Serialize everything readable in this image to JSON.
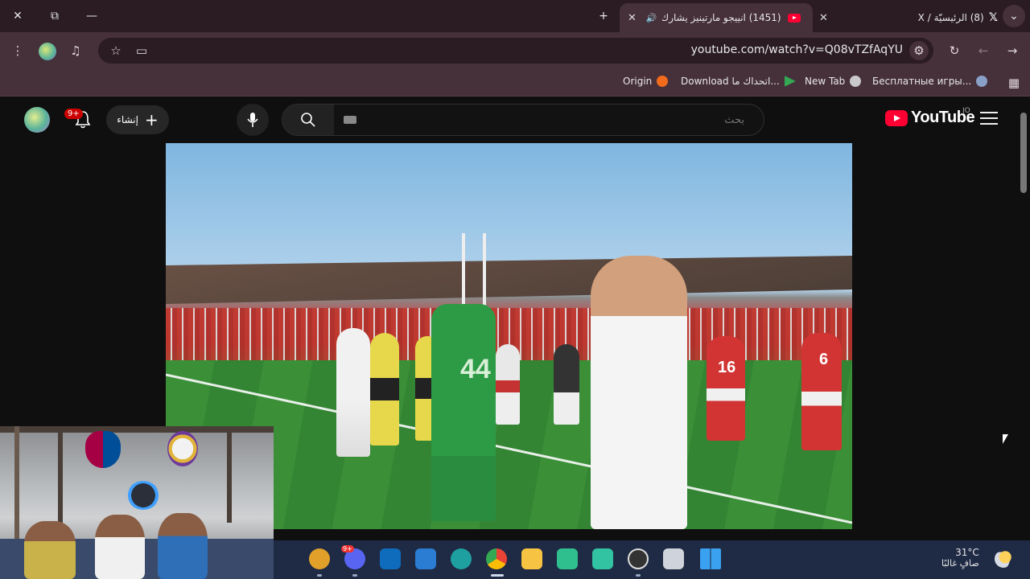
{
  "browser": {
    "tabs": [
      {
        "title": "(1451) انييجو مارتينيز يشارك",
        "favicon": "youtube-favicon",
        "active": true
      },
      {
        "title": "(8) الرئيسيّة / X",
        "favicon": "x-favicon",
        "active": false
      }
    ],
    "address": {
      "url": "youtube.com/watch?v=Q08vTZfAqYU"
    },
    "bookmarks": [
      {
        "label": "Origin",
        "icon": "origin-icon",
        "color": "#f26b1d"
      },
      {
        "label": "Download اتحداك ما...",
        "icon": "play-store-icon",
        "color": "#34a853"
      },
      {
        "label": "New Tab",
        "icon": "globe-icon",
        "color": "#c9c9c9"
      },
      {
        "label": "Бесплатные игры...",
        "icon": "gear-icon",
        "color": "#8aa0c8"
      }
    ]
  },
  "youtube": {
    "search": {
      "placeholder": "بحث"
    },
    "create_label": "إنشاء",
    "notification_count": "9+",
    "logo_text": "YouTube",
    "country_code": "JO",
    "brand_color": "#ff0033"
  },
  "video": {
    "jersey_number_green": "44",
    "jersey_number_red_1": "16",
    "jersey_number_red_2": "6"
  },
  "taskbar": {
    "apps": [
      {
        "name": "chrome-canary",
        "color": "#e0a02a"
      },
      {
        "name": "discord",
        "color": "#5865f2",
        "badge": "9+"
      },
      {
        "name": "outlook",
        "color": "#0f6cbd"
      },
      {
        "name": "microsoft-store",
        "color": "#2b7cd3"
      },
      {
        "name": "edge",
        "color": "#1fa0a0"
      },
      {
        "name": "chrome",
        "color": "#34a853"
      },
      {
        "name": "file-explorer",
        "color": "#f6c343"
      },
      {
        "name": "filmora",
        "color": "#2fbf8f"
      },
      {
        "name": "streamlabs",
        "color": "#31c3a2"
      },
      {
        "name": "obs",
        "color": "#333333"
      },
      {
        "name": "task-view",
        "color": "#cfd3db"
      },
      {
        "name": "windows-start",
        "color": "#3aa0f0"
      }
    ],
    "weather": {
      "temp": "31°C",
      "desc": "صافٍ غالبًا"
    }
  }
}
